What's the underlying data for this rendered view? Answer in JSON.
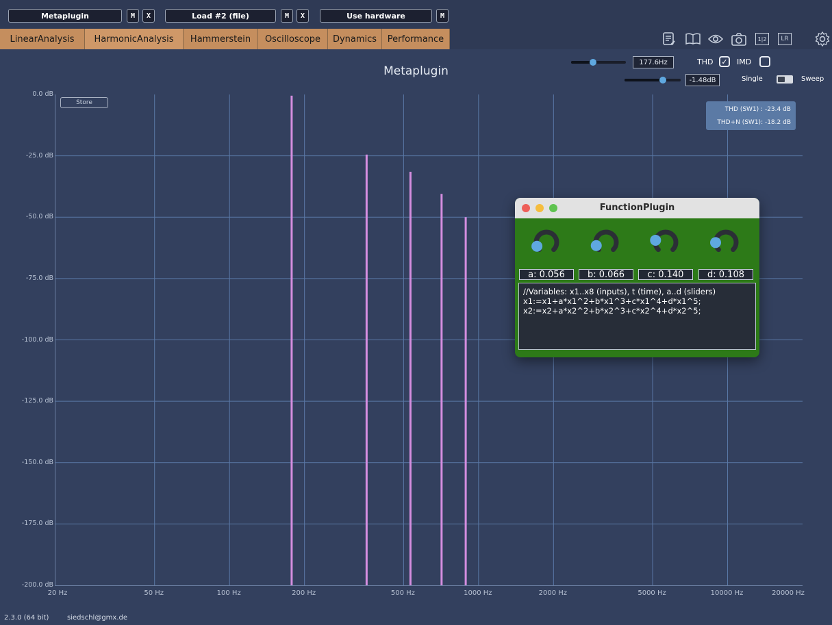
{
  "topbar": {
    "slots": [
      {
        "label": "Metaplugin",
        "buttons": [
          "M",
          "X"
        ]
      },
      {
        "label": "Load #2 (file)",
        "buttons": [
          "M",
          "X"
        ]
      },
      {
        "label": "Use hardware",
        "buttons": [
          "M"
        ]
      }
    ]
  },
  "tabs": [
    "LinearAnalysis",
    "HarmonicAnalysis",
    "Hammerstein",
    "Oscilloscope",
    "Dynamics",
    "Performance"
  ],
  "active_tab": "HarmonicAnalysis",
  "toolbar_icons": [
    "notes-icon",
    "book-icon",
    "eye-icon",
    "camera-icon",
    "channel-12-icon",
    "lr-icon",
    "settings-icon"
  ],
  "toolbar_icon_text": {
    "ch12": "1|2",
    "lr": "LR"
  },
  "controls": {
    "freq_value": "177.6Hz",
    "level_value": "-1.48dB",
    "thd_label": "THD",
    "imd_label": "IMD",
    "thd_checked": true,
    "imd_checked": false,
    "single_label": "Single",
    "sweep_label": "Sweep",
    "freq_slider_fraction": 0.4,
    "level_slider_fraction": 0.68
  },
  "plot": {
    "title": "Metaplugin",
    "store_label": "Store",
    "thd_readout": "THD (SW1) : -23.4 dB",
    "thdn_readout": "THD+N (SW1): -18.2 dB"
  },
  "chart_data": {
    "type": "bar",
    "title": "Metaplugin",
    "x_scale": "log",
    "xlim": [
      20,
      20000
    ],
    "ylim": [
      -200,
      0
    ],
    "x_ticks": [
      "20 Hz",
      "50 Hz",
      "100 Hz",
      "200 Hz",
      "500 Hz",
      "1000 Hz",
      "2000 Hz",
      "5000 Hz",
      "10000 Hz",
      "20000 Hz"
    ],
    "y_ticks": [
      "0.0 dB",
      "-25.0 dB",
      "-50.0 dB",
      "-75.0 dB",
      "-100.0 dB",
      "-125.0 dB",
      "-150.0 dB",
      "-175.0 dB",
      "-200.0 dB"
    ],
    "grid": true,
    "bar_color": "#d58ee0",
    "x": [
      177.6,
      355.2,
      532.8,
      710.4,
      888.0
    ],
    "values": [
      -0.5,
      -24.5,
      -31.5,
      -40.5,
      -50.0
    ]
  },
  "function_plugin": {
    "title": "FunctionPlugin",
    "params": [
      "a: 0.056",
      "b: 0.066",
      "c: 0.140",
      "d: 0.108"
    ],
    "knob_values": [
      0.056,
      0.066,
      0.14,
      0.108
    ],
    "code": "//Variables: x1..x8 (inputs), t (time), a..d (sliders)\nx1:=x1+a*x1^2+b*x1^3+c*x1^4+d*x1^5;\nx2:=x2+a*x2^2+b*x2^3+c*x2^4+d*x2^5;"
  },
  "footer": {
    "version": "2.3.0 (64 bit)",
    "email": "siedschl@gmx.de"
  },
  "colors": {
    "background": "#33405e",
    "tab": "#c58e5e",
    "accent": "#5fa8e0",
    "plugin_bg": "#2d7a18"
  }
}
